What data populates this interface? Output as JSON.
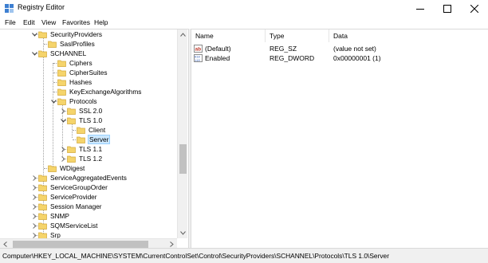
{
  "window": {
    "title": "Registry Editor",
    "icon": "registry-editor-icon"
  },
  "menu": [
    "File",
    "Edit",
    "View",
    "Favorites",
    "Help"
  ],
  "tree": [
    {
      "label": "SecurityProviders",
      "arrow": "down"
    },
    {
      "label": "SaslProfiles",
      "arrow": ""
    },
    {
      "label": "SCHANNEL",
      "arrow": "down"
    },
    {
      "label": "Ciphers",
      "arrow": ""
    },
    {
      "label": "CipherSuites",
      "arrow": ""
    },
    {
      "label": "Hashes",
      "arrow": ""
    },
    {
      "label": "KeyExchangeAlgorithms",
      "arrow": ""
    },
    {
      "label": "Protocols",
      "arrow": "down"
    },
    {
      "label": "SSL 2.0",
      "arrow": "right"
    },
    {
      "label": "TLS 1.0",
      "arrow": "down"
    },
    {
      "label": "Client",
      "arrow": ""
    },
    {
      "label": "Server",
      "arrow": "",
      "selected": true
    },
    {
      "label": "TLS 1.1",
      "arrow": "right"
    },
    {
      "label": "TLS 1.2",
      "arrow": "right"
    },
    {
      "label": "WDigest",
      "arrow": ""
    },
    {
      "label": "ServiceAggregatedEvents",
      "arrow": "right"
    },
    {
      "label": "ServiceGroupOrder",
      "arrow": "right"
    },
    {
      "label": "ServiceProvider",
      "arrow": "right"
    },
    {
      "label": "Session Manager",
      "arrow": "right"
    },
    {
      "label": "SNMP",
      "arrow": "right"
    },
    {
      "label": "SQMServiceList",
      "arrow": "right"
    },
    {
      "label": "Srp",
      "arrow": "right"
    }
  ],
  "values": {
    "columns": {
      "name": "Name",
      "type": "Type",
      "data": "Data"
    },
    "rows": [
      {
        "name": "(Default)",
        "type": "REG_SZ",
        "data": "(value not set)",
        "icon": "string-value-icon"
      },
      {
        "name": "Enabled",
        "type": "REG_DWORD",
        "data": "0x00000001 (1)",
        "icon": "binary-value-icon"
      }
    ]
  },
  "status": {
    "path": "Computer\\HKEY_LOCAL_MACHINE\\SYSTEM\\CurrentControlSet\\Control\\SecurityProviders\\SCHANNEL\\Protocols\\TLS 1.0\\Server"
  },
  "colors": {
    "folder": "#f5d46b",
    "selection": "#cce8ff",
    "selection_border": "#99d1ff",
    "string_icon": "#c0392b",
    "dword_icon": "#2e5bb8"
  }
}
